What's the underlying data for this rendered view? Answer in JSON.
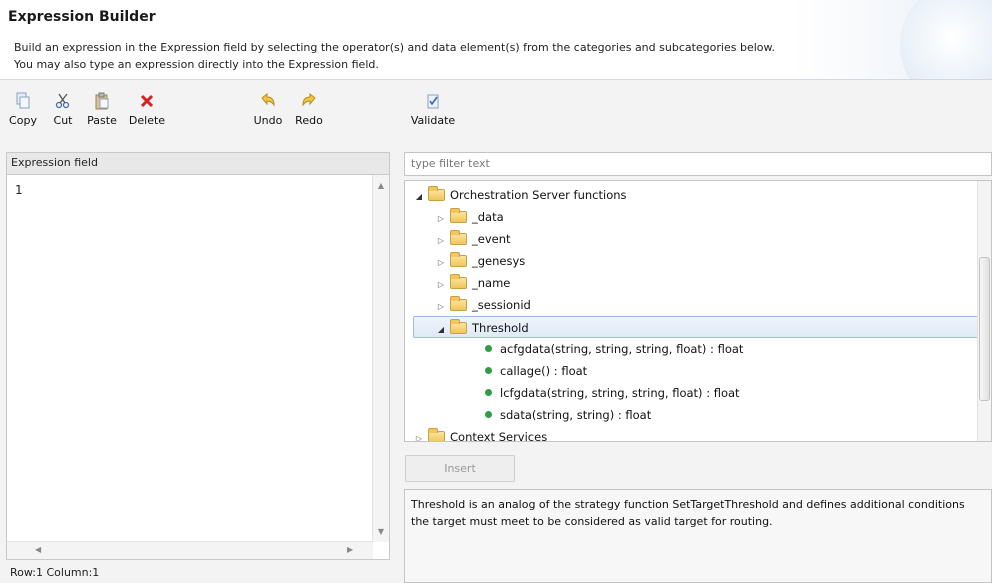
{
  "header": {
    "title": "Expression Builder",
    "description_line1": "Build an expression in the Expression field by selecting the operator(s) and data element(s) from the categories and subcategories below.",
    "description_line2": "You may also type an expression directly into the Expression field."
  },
  "toolbar": {
    "copy_label": "Copy",
    "cut_label": "Cut",
    "paste_label": "Paste",
    "delete_label": "Delete",
    "undo_label": "Undo",
    "redo_label": "Redo",
    "validate_label": "Validate"
  },
  "expression_panel": {
    "header": "Expression field",
    "line_number": "1",
    "status": "Row:1 Column:1"
  },
  "filter": {
    "placeholder": "type filter text"
  },
  "tree": {
    "root": "Orchestration Server functions",
    "children": [
      "_data",
      "_event",
      "_genesys",
      "_name",
      "_sessionid"
    ],
    "selected_folder": "Threshold",
    "functions": [
      "acfgdata(string, string, string, float) : float",
      "callage() : float",
      "lcfgdata(string, string, string, float) : float",
      "sdata(string, string) : float"
    ],
    "next_root": "Context Services"
  },
  "insert_label": "Insert",
  "description": "Threshold is an analog of the strategy function SetTargetThreshold and defines additional conditions the target must meet to be considered as valid target for routing.",
  "colors": {
    "accent_selection": "#dfeaf7",
    "function_dot": "#2e9e44",
    "delete_red": "#d42020"
  }
}
